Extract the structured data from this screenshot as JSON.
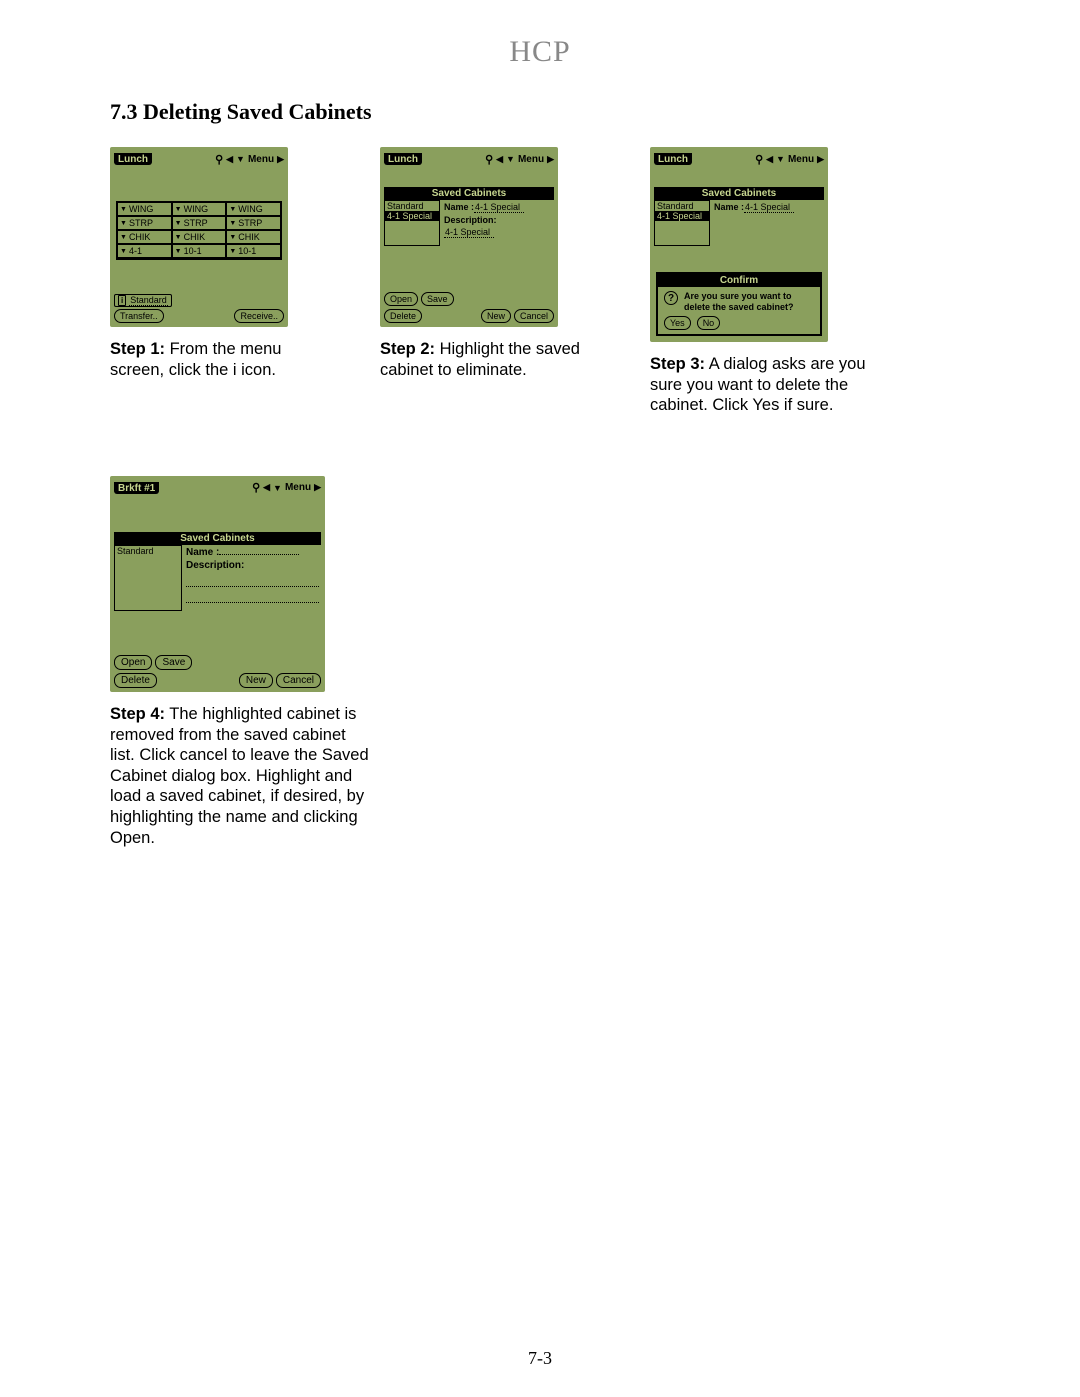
{
  "doc_header": "HCP",
  "section_title": "7.3 Deleting Saved Cabinets",
  "page_number": "7-3",
  "titlebar": {
    "menu_label": "Menu",
    "antenna_glyph": "⚲",
    "tri_left": "◀",
    "tri_right": "▶",
    "tri_down": "▼"
  },
  "screen1": {
    "title": "Lunch",
    "grid": [
      [
        "WING",
        "WING",
        "WING"
      ],
      [
        "STRP",
        "STRP",
        "STRP"
      ],
      [
        "CHIK",
        "CHIK",
        "CHIK"
      ],
      [
        "4-1",
        "10-1",
        "10-1"
      ]
    ],
    "i_icon": "i",
    "standard_label": "Standard",
    "transfer_btn": "Transfer..",
    "receive_btn": "Receive.."
  },
  "saved_cab_header": "Saved Cabinets",
  "field_name_label": "Name :",
  "field_desc_label": "Description:",
  "screen2": {
    "title": "Lunch",
    "list": [
      "Standard",
      "4-1 Special"
    ],
    "selected_index": 1,
    "name_value": "4-1 Special",
    "desc_value": "4-1 Special"
  },
  "screen3": {
    "title": "Lunch",
    "list": [
      "Standard",
      "4-1 Special"
    ],
    "selected_index": 1,
    "name_value": "4-1 Special",
    "confirm_title": "Confirm",
    "confirm_msg": "Are you sure you want to delete the saved cabinet?",
    "yes": "Yes",
    "no": "No"
  },
  "screen4": {
    "title": "Brkft #1",
    "list": [
      "Standard"
    ],
    "name_value": "",
    "desc_value": ""
  },
  "buttons": {
    "open": "Open",
    "save": "Save",
    "delete": "Delete",
    "new": "New",
    "cancel": "Cancel"
  },
  "captions": {
    "s1_bold": "Step 1:",
    "s1_text": " From the menu screen, click the i icon.",
    "s2_bold": "Step 2:",
    "s2_text": " Highlight the saved cabinet to eliminate.",
    "s3_bold": "Step 3:",
    "s3_text": " A dialog asks are you sure you want to delete the cabinet. Click Yes if sure.",
    "s4_bold": "Step 4:",
    "s4_text": " The highlighted cabinet is removed from the saved cabinet list. Click cancel to leave the Saved Cabinet dialog box. Highlight and load a saved cabinet, if desired, by highlighting the name and clicking Open."
  }
}
